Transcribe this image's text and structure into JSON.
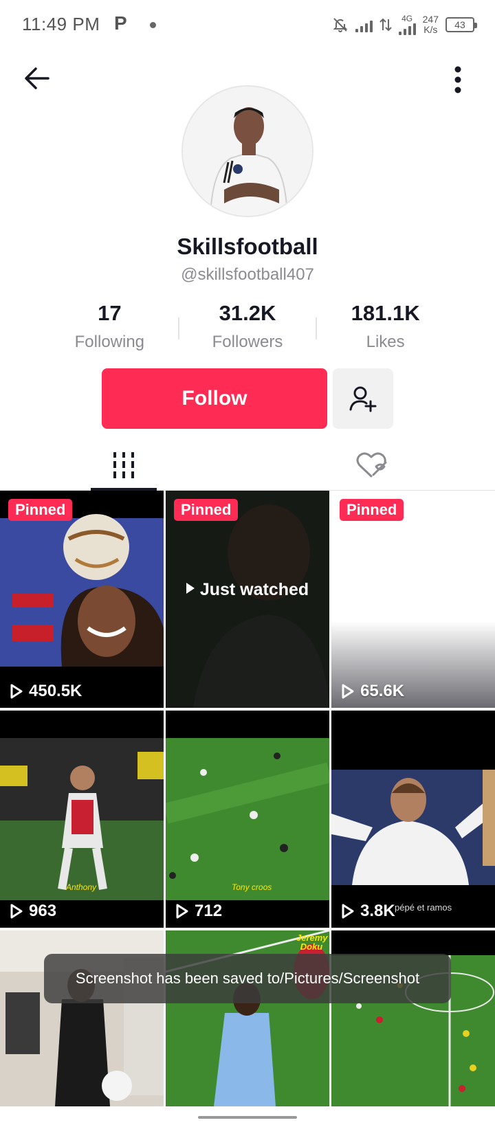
{
  "status_bar": {
    "time": "11:49 PM",
    "app_icon_letter": "P",
    "network_type": "4G",
    "speed_value": "247",
    "speed_unit": "K/s",
    "battery": "43"
  },
  "profile": {
    "display_name": "Skillsfootball",
    "username": "@skillsfootball407",
    "stats": [
      {
        "value": "17",
        "label": "Following"
      },
      {
        "value": "31.2K",
        "label": "Followers"
      },
      {
        "value": "181.1K",
        "label": "Likes"
      }
    ],
    "follow_label": "Follow"
  },
  "tabs": [
    {
      "name": "videos",
      "icon": "grid-icon",
      "active": true
    },
    {
      "name": "liked",
      "icon": "hidden-heart-icon",
      "active": false
    }
  ],
  "videos": [
    {
      "pinned_label": "Pinned",
      "views": "450.5K"
    },
    {
      "pinned_label": "Pinned",
      "overlay": "Just watched"
    },
    {
      "pinned_label": "Pinned",
      "views": "65.6K"
    },
    {
      "views": "963",
      "caption": "Anthony"
    },
    {
      "views": "712",
      "caption": "Tony croos"
    },
    {
      "views": "3.8K",
      "caption": "pépé et ramos"
    },
    {},
    {
      "caption": "Jeremy Doku"
    },
    {}
  ],
  "toast": {
    "message": "Screenshot has been saved to/Pictures/Screenshot"
  },
  "colors": {
    "accent": "#fe2c55",
    "text_primary": "#161823",
    "text_secondary": "#8a8b91"
  }
}
